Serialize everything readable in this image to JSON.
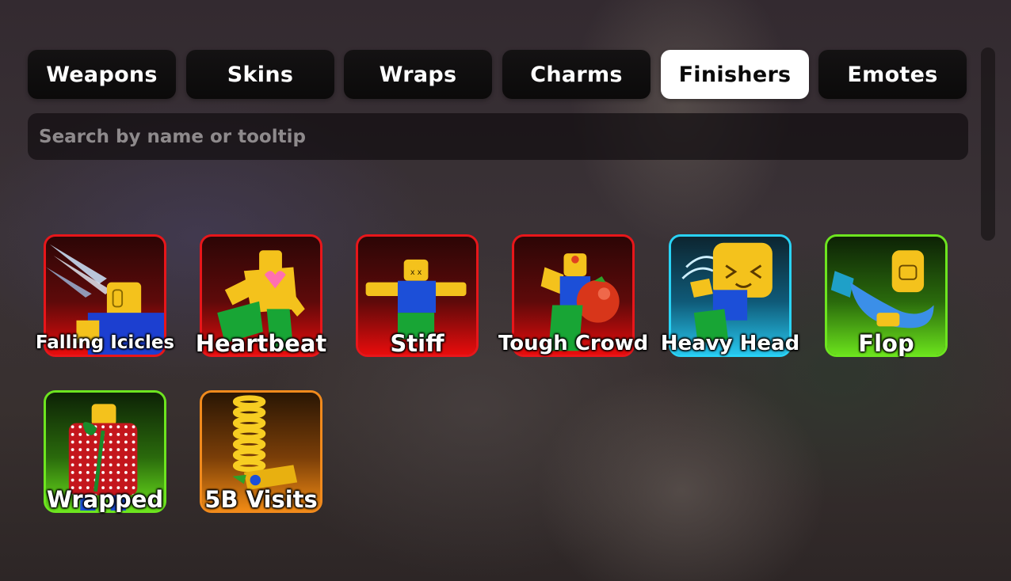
{
  "tabs": [
    {
      "label": "Weapons",
      "active": false
    },
    {
      "label": "Skins",
      "active": false
    },
    {
      "label": "Wraps",
      "active": false
    },
    {
      "label": "Charms",
      "active": false
    },
    {
      "label": "Finishers",
      "active": true
    },
    {
      "label": "Emotes",
      "active": false
    }
  ],
  "search": {
    "placeholder": "Search by name or tooltip",
    "value": ""
  },
  "items": [
    {
      "name": "Falling Icicles",
      "rarity_color": "#e8161a",
      "icon": "falling-icicles-icon"
    },
    {
      "name": "Heartbeat",
      "rarity_color": "#e8161a",
      "icon": "heartbeat-icon"
    },
    {
      "name": "Stiff",
      "rarity_color": "#e8161a",
      "icon": "stiff-icon"
    },
    {
      "name": "Tough Crowd",
      "rarity_color": "#e8161a",
      "icon": "tough-crowd-icon"
    },
    {
      "name": "Heavy Head",
      "rarity_color": "#29d3f6",
      "icon": "heavy-head-icon"
    },
    {
      "name": "Flop",
      "rarity_color": "#6de51f",
      "icon": "flop-icon"
    },
    {
      "name": "Wrapped",
      "rarity_color": "#6de51f",
      "icon": "wrapped-icon"
    },
    {
      "name": "5B Visits",
      "rarity_color": "#f18a1c",
      "icon": "5b-visits-icon"
    }
  ]
}
